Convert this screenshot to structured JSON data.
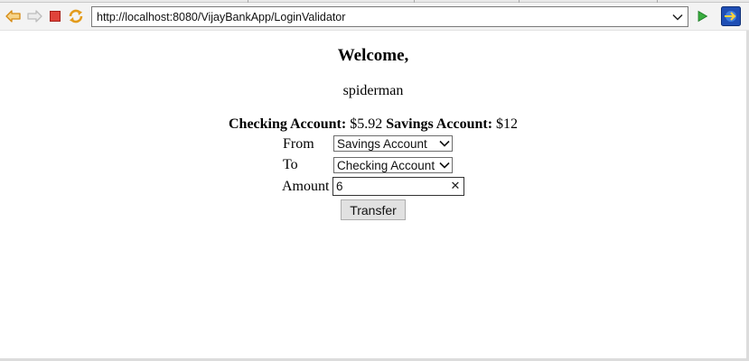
{
  "browser": {
    "url": "http://localhost:8080/VijayBankApp/LoginValidator",
    "icons": {
      "back": "back-arrow-icon",
      "forward": "forward-arrow-icon",
      "stop": "stop-icon",
      "refresh": "refresh-icon",
      "go": "go-icon",
      "open": "open-web-browser-icon",
      "url_dropdown": "chevron-down-icon"
    },
    "colors": {
      "back_arrow": "#e8a21a",
      "stop": "#d9312b",
      "go": "#2fa33b",
      "open_icon_bg": "#1f4fb5"
    }
  },
  "page": {
    "welcome": "Welcome,",
    "username": "spiderman",
    "balances": {
      "checking_label": "Checking Account:",
      "checking_value": "$5.92",
      "savings_label": "Savings Account:",
      "savings_value": "$12"
    },
    "form": {
      "from_label": "From",
      "from_selected": "Savings Account",
      "to_label": "To",
      "to_selected": "Checking Account",
      "amount_label": "Amount",
      "amount_value": "6",
      "clear_glyph": "✕",
      "transfer_label": "Transfer"
    }
  }
}
